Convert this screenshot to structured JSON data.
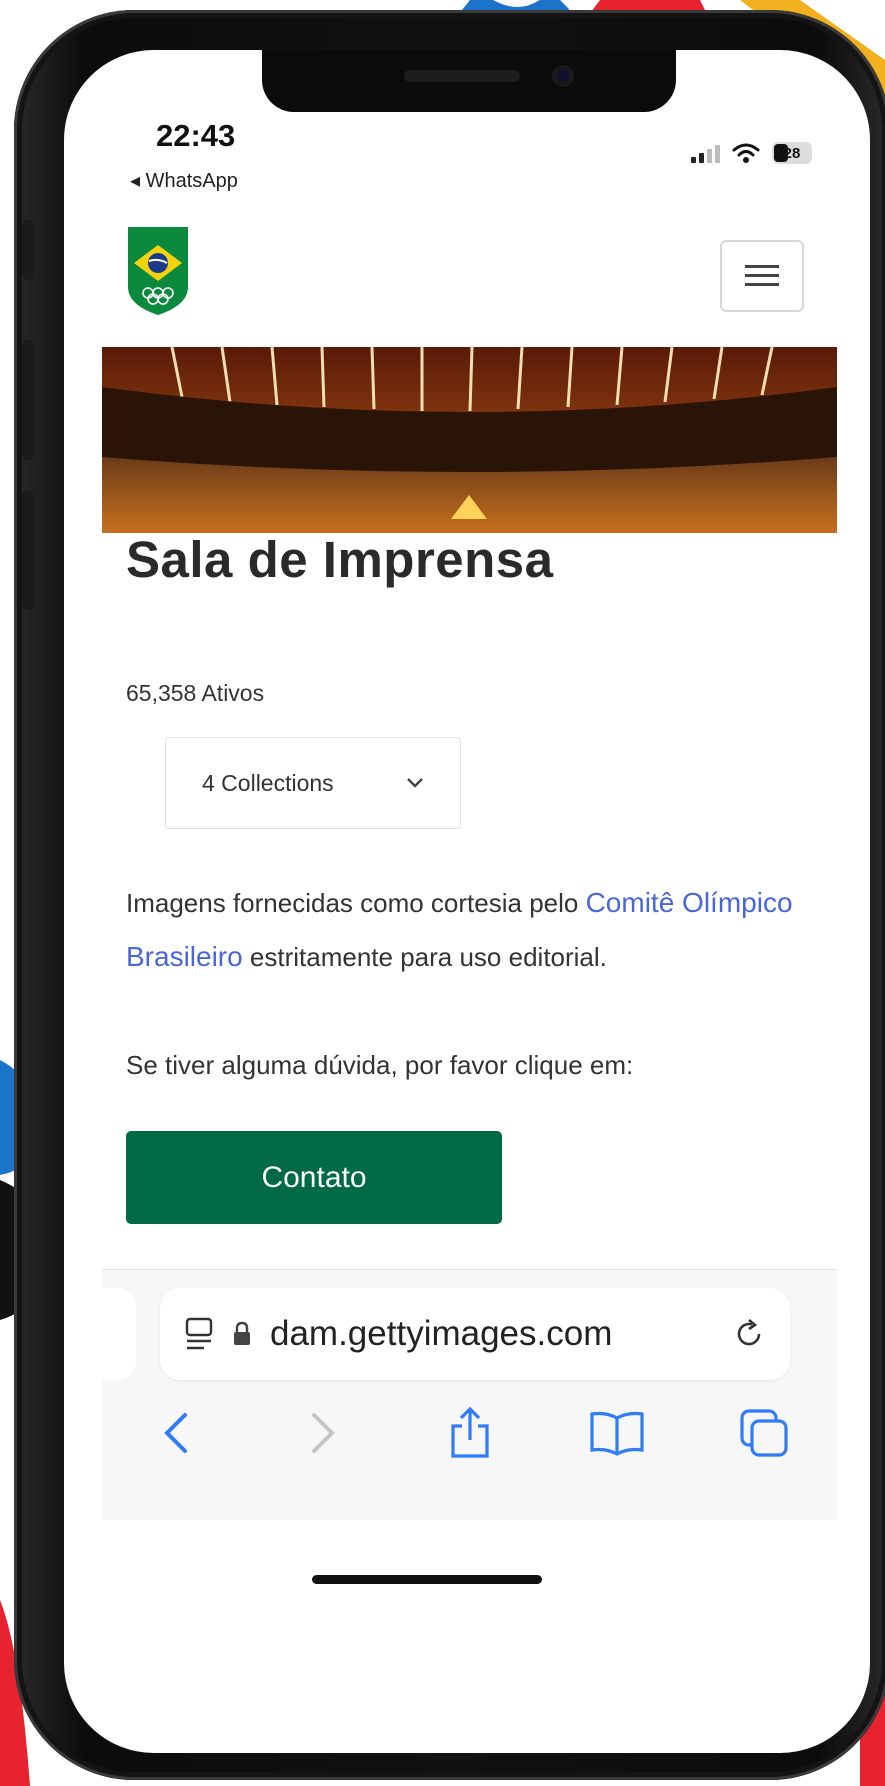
{
  "status_bar": {
    "time": "22:43",
    "back_app": "◂ WhatsApp",
    "battery": "28"
  },
  "page": {
    "title": "Sala de Imprensa",
    "asset_count": "65,358 Ativos",
    "collections_select": "4 Collections",
    "description_before": "Imagens fornecidas como cortesia pelo ",
    "description_link": "Comitê Olímpico Brasileiro",
    "description_after": " estritamente para uso editorial.",
    "question": "Se tiver alguma dúvida, por favor clique em:",
    "contact_button": "Contato"
  },
  "browser": {
    "url": "dam.gettyimages.com"
  },
  "colors": {
    "accent_green": "#006a47",
    "link_blue": "#4a67d9",
    "ios_blue": "#2f7cf6"
  },
  "icons": {
    "logo": "brasil-olympic-logo",
    "menu": "hamburger-menu-icon",
    "dropdown": "chevron-down-icon",
    "reader": "reader-mode-icon",
    "lock": "lock-icon",
    "reload": "reload-icon",
    "back": "chevron-left-icon",
    "forward": "chevron-right-icon",
    "share": "share-icon",
    "bookmarks": "book-icon",
    "tabs": "tabs-icon"
  }
}
